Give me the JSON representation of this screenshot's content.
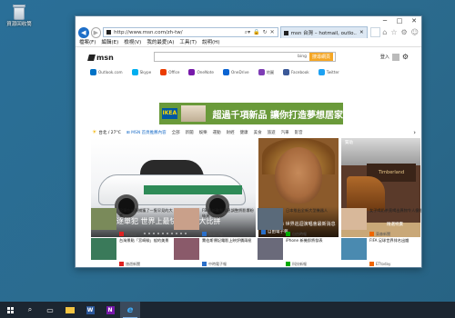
{
  "desktop": {
    "recycle_label": "資源回收筒"
  },
  "browser": {
    "url": "http://www.msn.com/zh-tw/",
    "tab_title": "msn 台灣 – hotmail, outlo...",
    "menu": [
      "檔案(F)",
      "編輯(E)",
      "檢視(V)",
      "我的最愛(A)",
      "工具(T)",
      "說明(H)"
    ]
  },
  "msn": {
    "logo": "msn",
    "search_engine": "bing",
    "search_button": "搜尋網頁",
    "login": "登入"
  },
  "links": [
    {
      "label": "Outlook.com",
      "color": "#0072c6"
    },
    {
      "label": "Skype",
      "color": "#00aff0"
    },
    {
      "label": "Office",
      "color": "#eb3c00"
    },
    {
      "label": "OneNote",
      "color": "#7719aa"
    },
    {
      "label": "OneDrive",
      "color": "#0a64d2"
    },
    {
      "label": "地圖",
      "color": "#7e3db5"
    },
    {
      "label": "Facebook",
      "color": "#3b5998"
    },
    {
      "label": "Twitter",
      "color": "#1da1f2"
    }
  ],
  "banner": {
    "brand": "IKEA",
    "text": "超過千項新品 讓你打造夢想居家"
  },
  "nav_tabs": {
    "weather": "台北 / 27°C",
    "items": [
      "⊞ MSN 首頁推薦內容",
      "全部",
      "新聞",
      "娛樂",
      "運動",
      "財經",
      "健康",
      "美食",
      "旅遊",
      "汽車",
      "影音"
    ]
  },
  "hero": {
    "caption": "高速追逐單犯 世界上最快的警車大比拼"
  },
  "card2": {
    "caption": "歌手碧昂絲 世界巡迴演唱會最新消息",
    "source": "自由電子報"
  },
  "card3": {
    "tag": "贊助",
    "brand": "Timberland",
    "sale": "精選特賣"
  },
  "small_cards": [
    {
      "title": "民眾在街頭捕獲了一隻罕見的大鷹",
      "source": "新頭殼"
    },
    {
      "title": "FB 最新動態消息調整將影響粉絲頁",
      "source": "蘋果日報"
    },
    {
      "title": "日本推出全新大型機器人",
      "source": "自由時報"
    },
    {
      "title": "女子喝奶茶竟喝出異物令人傻眼",
      "source": "東森新聞"
    },
    {
      "title": "台灣景點「宮崎駿」般的美景",
      "source": "旅遊新聞"
    },
    {
      "title": "賈伯斯傳記電影上映評價兩極",
      "source": "中時電子報"
    },
    {
      "title": "iPhone 新機即將發表",
      "source": "科技新報"
    },
    {
      "title": "FIFA 足球世界排名出爐",
      "source": "ETtoday"
    },
    {
      "title": "健康飲食五大原則",
      "source": "康健雜誌"
    },
    {
      "title": "SUV 市場持續成長",
      "source": "汽車日報"
    },
    {
      "title": "年輕人理財觀念大調查",
      "source": "經濟日報"
    },
    {
      "title": "二六歲大學生創業賣咖啡",
      "source": "商業周刊"
    }
  ],
  "taskbar": [
    "start",
    "search",
    "task-view",
    "file-explorer",
    "word",
    "onenote",
    "internet-explorer"
  ]
}
